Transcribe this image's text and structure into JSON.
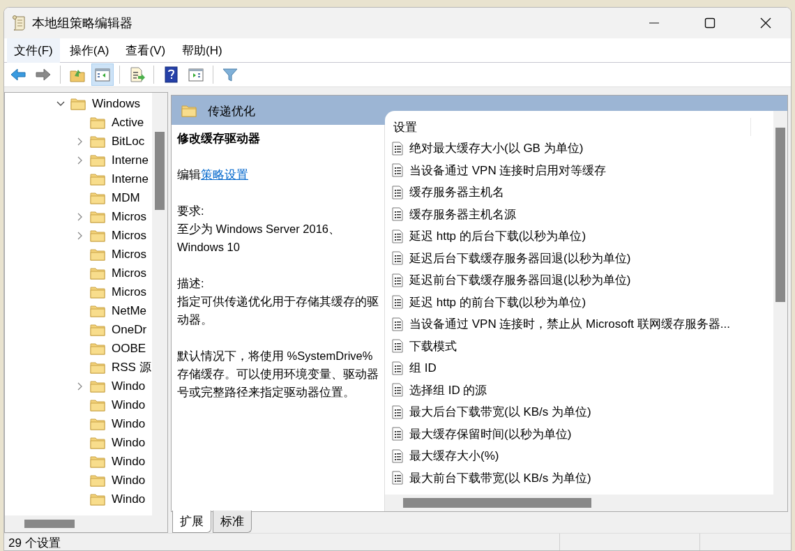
{
  "window": {
    "title": "本地组策略编辑器"
  },
  "menu": [
    {
      "label": "文件(F)",
      "highlighted": true
    },
    {
      "label": "操作(A)",
      "highlighted": false
    },
    {
      "label": "查看(V)",
      "highlighted": false
    },
    {
      "label": "帮助(H)",
      "highlighted": false
    }
  ],
  "toolbar": [
    {
      "kind": "back",
      "pressed": false
    },
    {
      "kind": "forward",
      "pressed": false
    },
    {
      "kind": "sep"
    },
    {
      "kind": "up",
      "pressed": false
    },
    {
      "kind": "tree",
      "pressed": true
    },
    {
      "kind": "sep"
    },
    {
      "kind": "export",
      "pressed": false
    },
    {
      "kind": "sep"
    },
    {
      "kind": "help",
      "pressed": false
    },
    {
      "kind": "pane",
      "pressed": false
    },
    {
      "kind": "sep"
    },
    {
      "kind": "filter",
      "pressed": false
    }
  ],
  "tree": [
    {
      "label": "Windows",
      "expanded": true,
      "children": [
        {
          "label": "Active",
          "expandable": false
        },
        {
          "label": "BitLoc",
          "expandable": true
        },
        {
          "label": "Interne",
          "expandable": true
        },
        {
          "label": "Interne",
          "expandable": false
        },
        {
          "label": "MDM",
          "expandable": false
        },
        {
          "label": "Micros",
          "expandable": true
        },
        {
          "label": "Micros",
          "expandable": true
        },
        {
          "label": "Micros",
          "expandable": false
        },
        {
          "label": "Micros",
          "expandable": false
        },
        {
          "label": "Micros",
          "expandable": false
        },
        {
          "label": "NetMe",
          "expandable": false
        },
        {
          "label": "OneDr",
          "expandable": false
        },
        {
          "label": "OOBE",
          "expandable": false
        },
        {
          "label": "RSS 源",
          "expandable": false
        },
        {
          "label": "Windo",
          "expandable": true
        },
        {
          "label": "Windo",
          "expandable": false
        },
        {
          "label": "Windo",
          "expandable": false
        },
        {
          "label": "Windo",
          "expandable": false
        },
        {
          "label": "Windo",
          "expandable": false
        },
        {
          "label": "Windo",
          "expandable": false
        },
        {
          "label": "Windo",
          "expandable": false
        }
      ]
    }
  ],
  "details": {
    "folder": "传递优化",
    "description": {
      "title": "修改缓存驱动器",
      "edit_prefix": "编辑",
      "edit_link": "策略设置",
      "requirements_label": "要求:",
      "requirements": "至少为 Windows Server 2016、Windows 10",
      "description_label": "描述:",
      "paragraphs": [
        "指定可供传递优化用于存储其缓存的驱动器。",
        "默认情况下，将使用 %SystemDrive% 存储缓存。可以使用环境变量、驱动器号或完整路径来指定驱动器位置。"
      ]
    },
    "list": {
      "column": "设置",
      "rows": [
        "绝对最大缓存大小(以 GB 为单位)",
        "当设备通过 VPN 连接时启用对等缓存",
        "缓存服务器主机名",
        "缓存服务器主机名源",
        "延迟 http 的后台下载(以秒为单位)",
        "延迟后台下载缓存服务器回退(以秒为单位)",
        "延迟前台下载缓存服务器回退(以秒为单位)",
        "延迟 http 的前台下载(以秒为单位)",
        "当设备通过 VPN 连接时，禁止从 Microsoft 联网缓存服务器...",
        "下载模式",
        "组 ID",
        "选择组 ID 的源",
        "最大后台下载带宽(以 KB/s 为单位)",
        "最大缓存保留时间(以秒为单位)",
        "最大缓存大小(%)",
        "最大前台下载带宽(以 KB/s 为单位)"
      ]
    }
  },
  "tabs": [
    {
      "label": "扩展",
      "selected": true
    },
    {
      "label": "标准",
      "selected": false
    }
  ],
  "status_bar": "29 个设置"
}
